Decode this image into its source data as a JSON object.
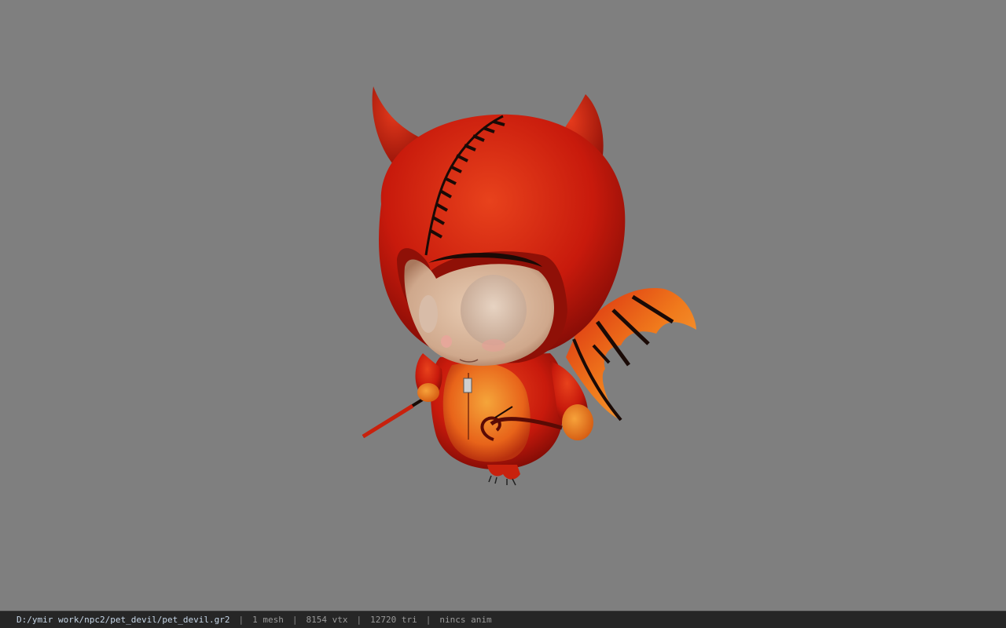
{
  "viewer": {
    "background_color": "#7f7f7f",
    "model_icon": "devil-pet-model"
  },
  "statusbar": {
    "file_path": "D:/ymir work/npc2/pet_devil/pet_devil.gr2",
    "separator": "|",
    "mesh_count": "1 mesh",
    "vertex_count": "8154 vtx",
    "triangle_count": "12720 tri",
    "anim_status": "nincs anim"
  }
}
